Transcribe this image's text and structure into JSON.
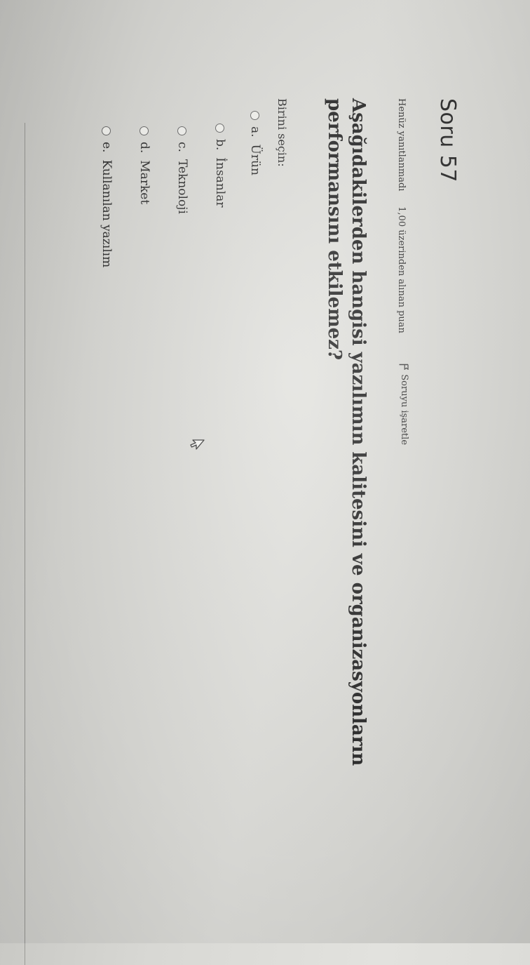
{
  "question": {
    "title": "Soru 57",
    "status": "Henüz yanıtlanmadı",
    "grade": "1,00 üzerinden alınan puan",
    "flag_label": "Soruyu işaretle",
    "text": "Aşağıdakilerden hangisi yazılımın kalitesini ve organizasyonların performansını etkilemez?",
    "prompt": "Birini seçin:"
  },
  "options": [
    {
      "letter": "a.",
      "text": "Ürün"
    },
    {
      "letter": "b.",
      "text": "İnsanlar"
    },
    {
      "letter": "c.",
      "text": "Teknoloji"
    },
    {
      "letter": "d.",
      "text": "Market"
    },
    {
      "letter": "e.",
      "text": "Kullanılan yazılım"
    }
  ],
  "icons": {
    "flag": "flag-icon",
    "cursor": "mouse-pointer-icon",
    "radio": "radio-circle"
  },
  "colors": {
    "text": "#2a2a2a",
    "background": "#dcdcd8"
  }
}
